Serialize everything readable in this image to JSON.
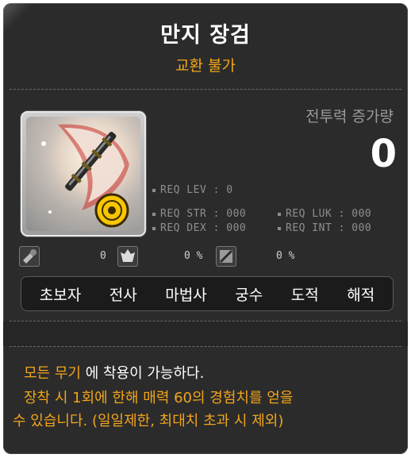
{
  "item": {
    "name": "만지 장검",
    "trade_status": "교환 불가"
  },
  "combat_power": {
    "label": "전투력 증가량",
    "value": "0"
  },
  "requirements": {
    "lev": "REQ LEV :     0",
    "str": "REQ STR : 000",
    "luk": "REQ LUK : 000",
    "dex": "REQ DEX : 000",
    "int": "REQ INT : 000"
  },
  "stats": {
    "first": "0",
    "second": "0 %",
    "third": "0 %"
  },
  "jobs": [
    "초보자",
    "전사",
    "마법사",
    "궁수",
    "도적",
    "해적"
  ],
  "description": {
    "line1_accent": "모든 무기",
    "line1_rest": " 에 착용이 가능하다.",
    "line2": "장착 시 1회에 한해 매력 60의 경험치를 얻을",
    "line3": "수 있습니다. (일일제한, 최대치 초과 시 제외)"
  },
  "colors": {
    "accent": "#f2a51b",
    "background": "#2b2b2b",
    "text": "#ffffff"
  }
}
